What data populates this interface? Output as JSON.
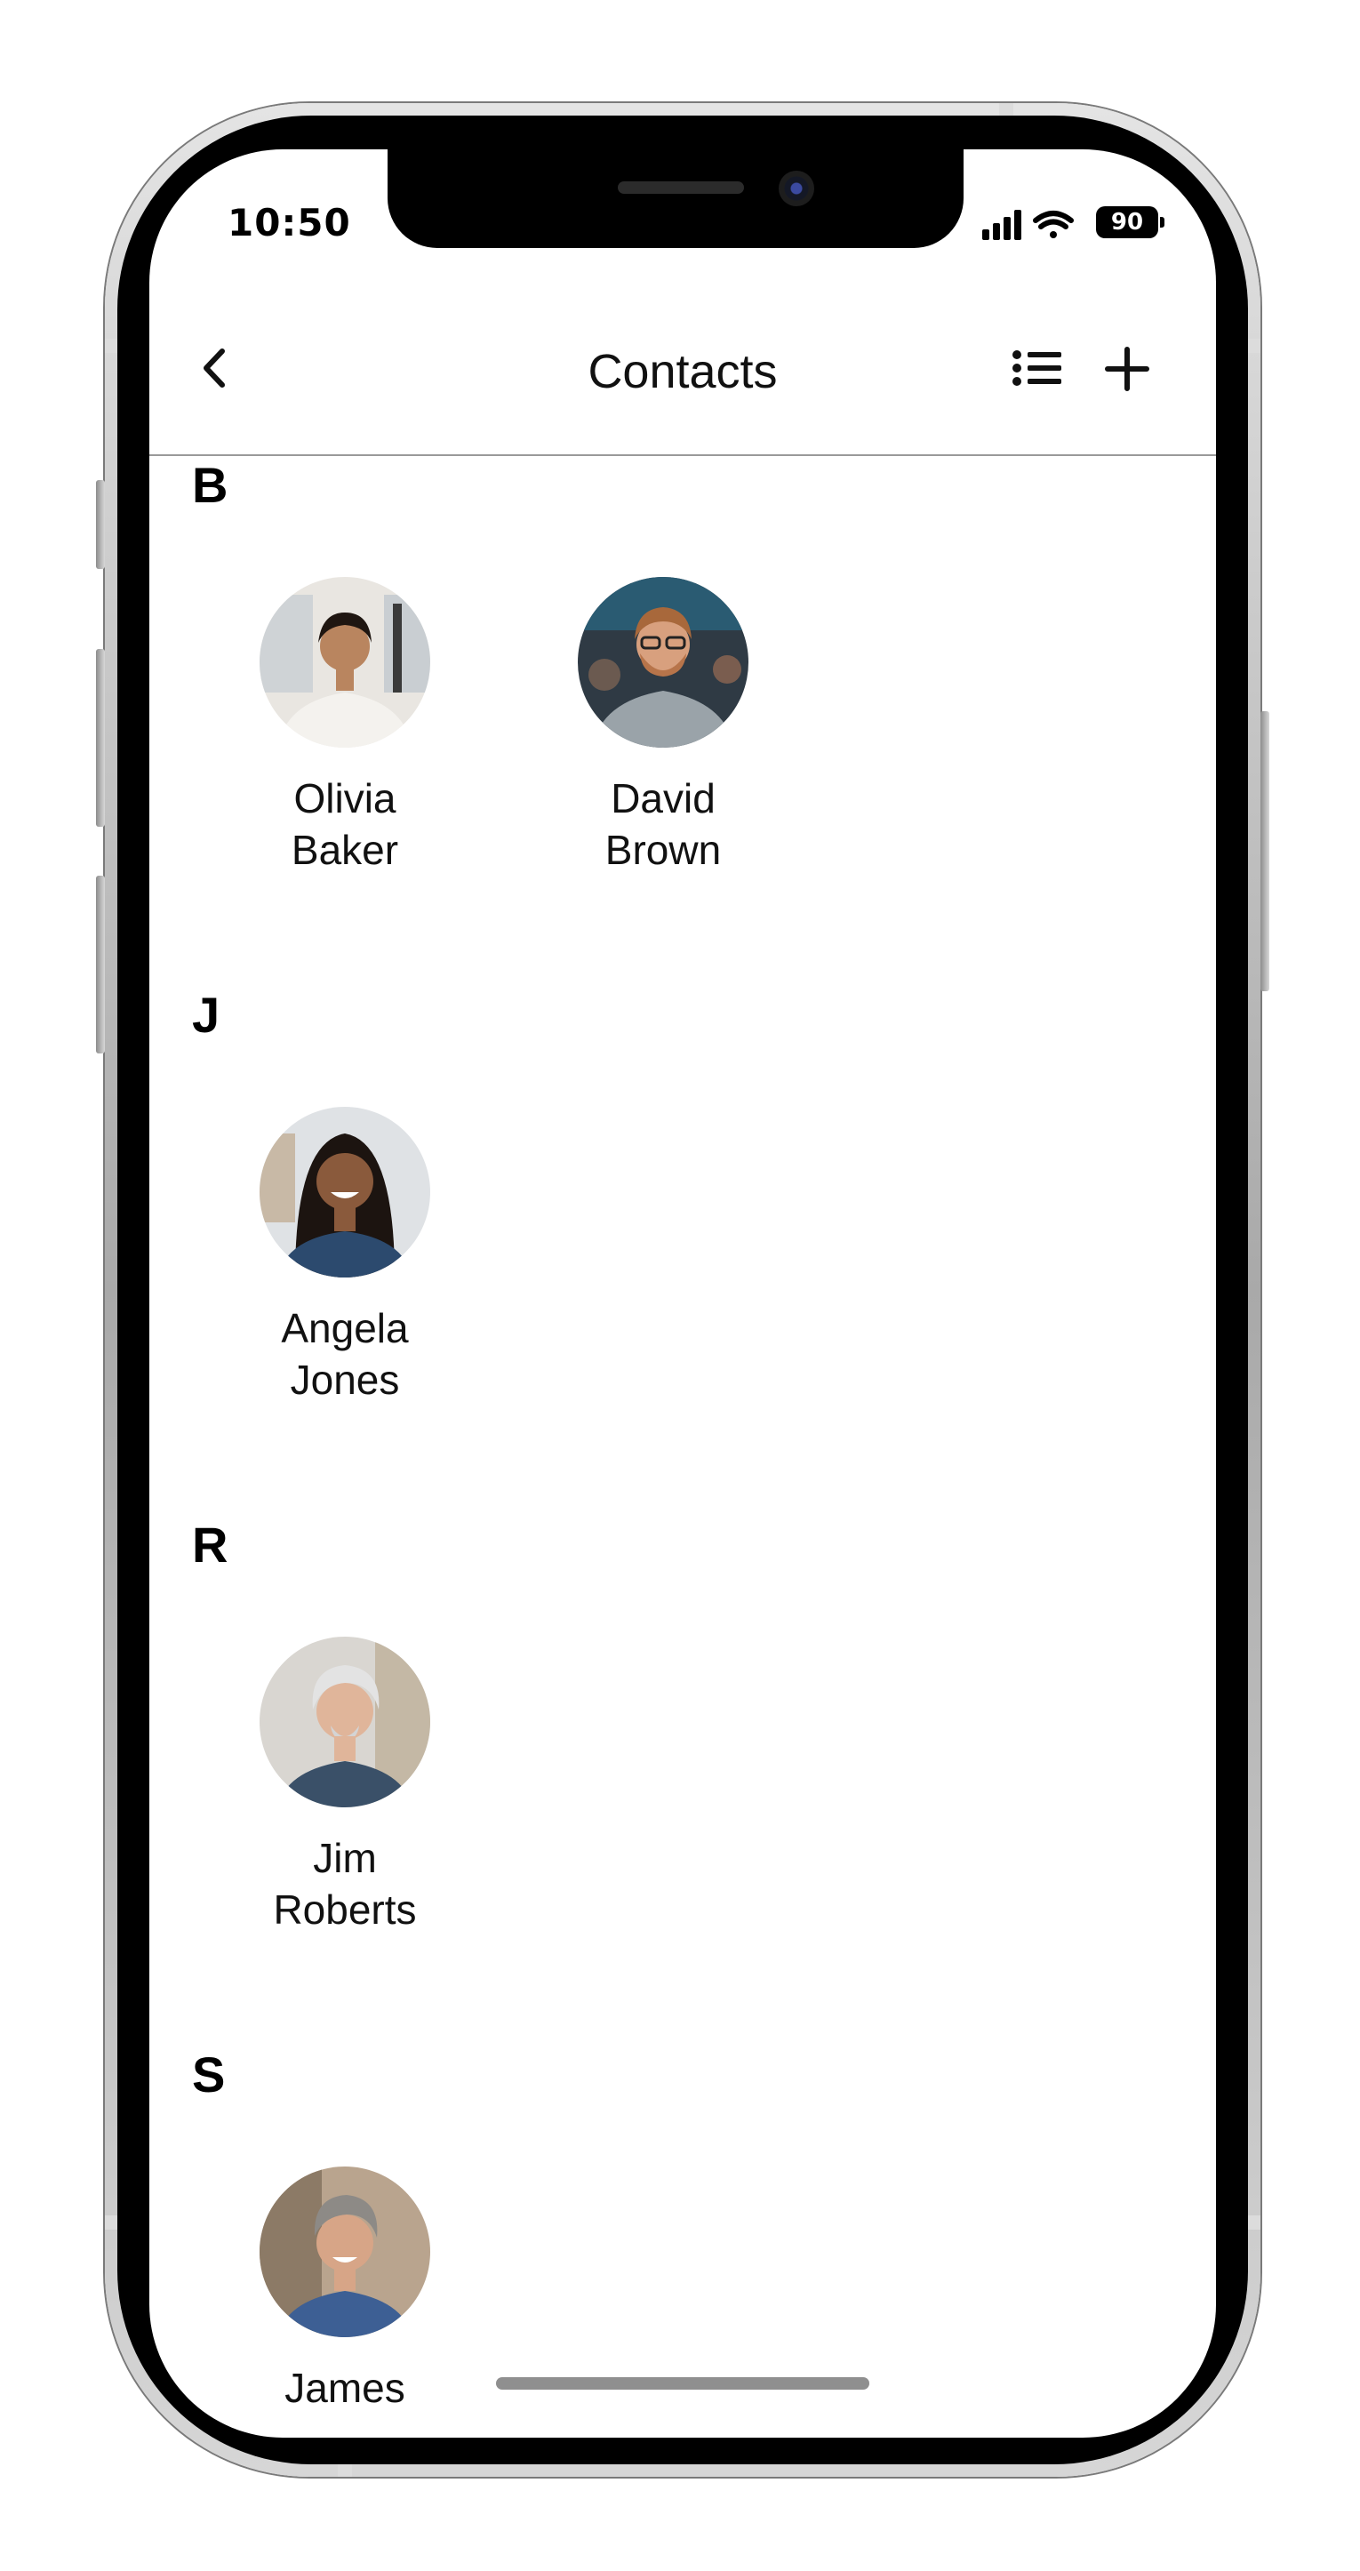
{
  "status_bar": {
    "time": "10:50",
    "battery": "90"
  },
  "nav": {
    "title": "Contacts",
    "back_icon": "chevron-left-icon",
    "list_icon": "list-icon",
    "add_icon": "plus-icon"
  },
  "sections": [
    {
      "letter": "B",
      "contacts": [
        {
          "first": "Olivia",
          "last": "Baker"
        },
        {
          "first": "David",
          "last": "Brown"
        }
      ]
    },
    {
      "letter": "J",
      "contacts": [
        {
          "first": "Angela",
          "last": "Jones"
        }
      ]
    },
    {
      "letter": "R",
      "contacts": [
        {
          "first": "Jim",
          "last": "Roberts"
        }
      ]
    },
    {
      "letter": "S",
      "contacts": [
        {
          "first": "James",
          "last": ""
        }
      ]
    }
  ]
}
